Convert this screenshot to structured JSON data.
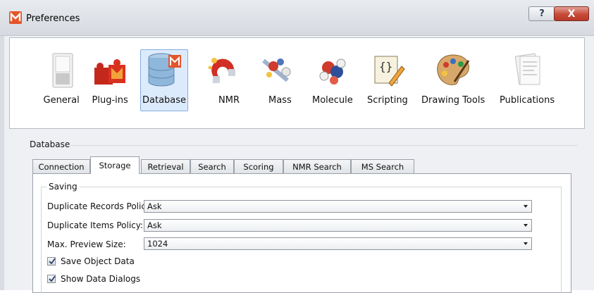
{
  "window": {
    "title": "Preferences",
    "help_glyph": "?",
    "close_glyph": "X"
  },
  "toolbar": {
    "items": [
      {
        "label": "General",
        "icon": "general-icon",
        "selected": false
      },
      {
        "label": "Plug-ins",
        "icon": "plugin-icon",
        "selected": false
      },
      {
        "label": "Database",
        "icon": "database-icon",
        "selected": true
      },
      {
        "label": "NMR",
        "icon": "nmr-icon",
        "selected": false
      },
      {
        "label": "Mass",
        "icon": "mass-icon",
        "selected": false
      },
      {
        "label": "Molecule",
        "icon": "molecule-icon",
        "selected": false
      },
      {
        "label": "Scripting",
        "icon": "scripting-icon",
        "selected": false
      },
      {
        "label": "Drawing Tools",
        "icon": "palette-icon",
        "selected": false
      },
      {
        "label": "Publications",
        "icon": "publications-icon",
        "selected": false
      }
    ]
  },
  "section": {
    "title": "Database"
  },
  "tabs": [
    {
      "label": "Connection",
      "active": false
    },
    {
      "label": "Storage",
      "active": true
    },
    {
      "label": "Retrieval",
      "active": false
    },
    {
      "label": "Search",
      "active": false
    },
    {
      "label": "Scoring",
      "active": false
    },
    {
      "label": "NMR Search",
      "active": false
    },
    {
      "label": "MS Search",
      "active": false
    }
  ],
  "saving": {
    "title": "Saving",
    "fields": [
      {
        "label": "Duplicate Records Policy:",
        "value": "Ask"
      },
      {
        "label": "Duplicate Items Policy:",
        "value": "Ask"
      },
      {
        "label": "Max. Preview Size:",
        "value": "1024"
      }
    ],
    "checkboxes": [
      {
        "label": "Save Object Data",
        "checked": true
      },
      {
        "label": "Show Data Dialogs",
        "checked": true
      }
    ]
  },
  "colors": {
    "selected_tile": "#dcebfc",
    "close_button": "#c84a38"
  }
}
